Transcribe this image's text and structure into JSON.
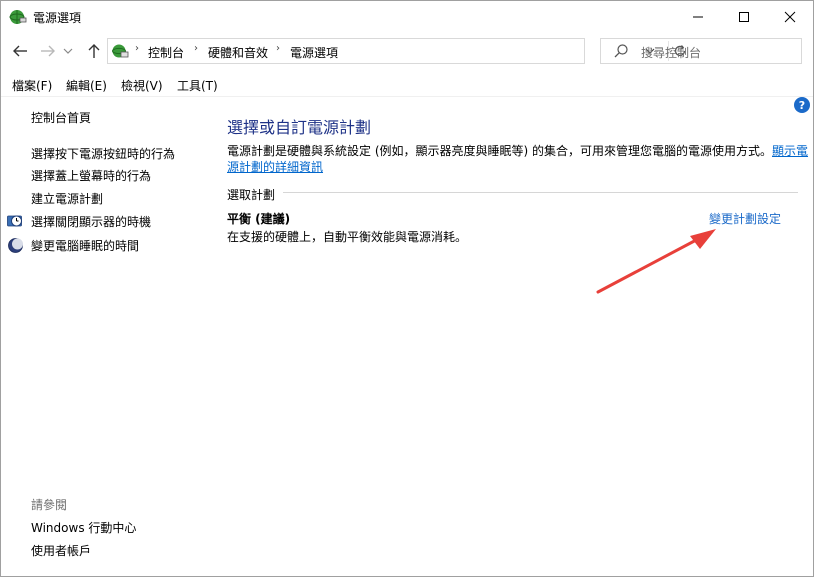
{
  "window": {
    "title": "電源選項"
  },
  "navigation": {
    "breadcrumb": [
      "控制台",
      "硬體和音效",
      "電源選項"
    ],
    "search_placeholder": "搜尋控制台"
  },
  "menu": {
    "items": [
      "檔案(F)",
      "編輯(E)",
      "檢視(V)",
      "工具(T)"
    ]
  },
  "sidebar": {
    "home": "控制台首頁",
    "links": [
      {
        "label": "選擇按下電源按鈕時的行為",
        "icon": "none"
      },
      {
        "label": "選擇蓋上螢幕時的行為",
        "icon": "none"
      },
      {
        "label": "建立電源計劃",
        "icon": "none"
      },
      {
        "label": "選擇關閉顯示器的時機",
        "icon": "clock-monitor-icon"
      },
      {
        "label": "變更電腦睡眠的時間",
        "icon": "moon-icon"
      }
    ],
    "see_also_title": "請參閱",
    "see_also": [
      "Windows 行動中心",
      "使用者帳戶"
    ]
  },
  "main": {
    "title": "選擇或自訂電源計劃",
    "description_line1_prefix": "電源計劃是硬體與系統設定 (例如，顯示器亮度與睡眠等) 的集合，可用來管理您電腦的電源使用方式。",
    "description_link_part1": "顯示電",
    "description_link_part2": "源計劃的詳細資訊",
    "section_label": "選取計劃",
    "plan": {
      "name": "平衡 (建議)",
      "description": "在支援的硬體上，自動平衡效能與電源消耗。",
      "change_link": "變更計劃設定"
    }
  },
  "colors": {
    "title_blue": "#1e3287",
    "link_blue": "#1b6ac9",
    "arrow_red": "#e8403a"
  }
}
